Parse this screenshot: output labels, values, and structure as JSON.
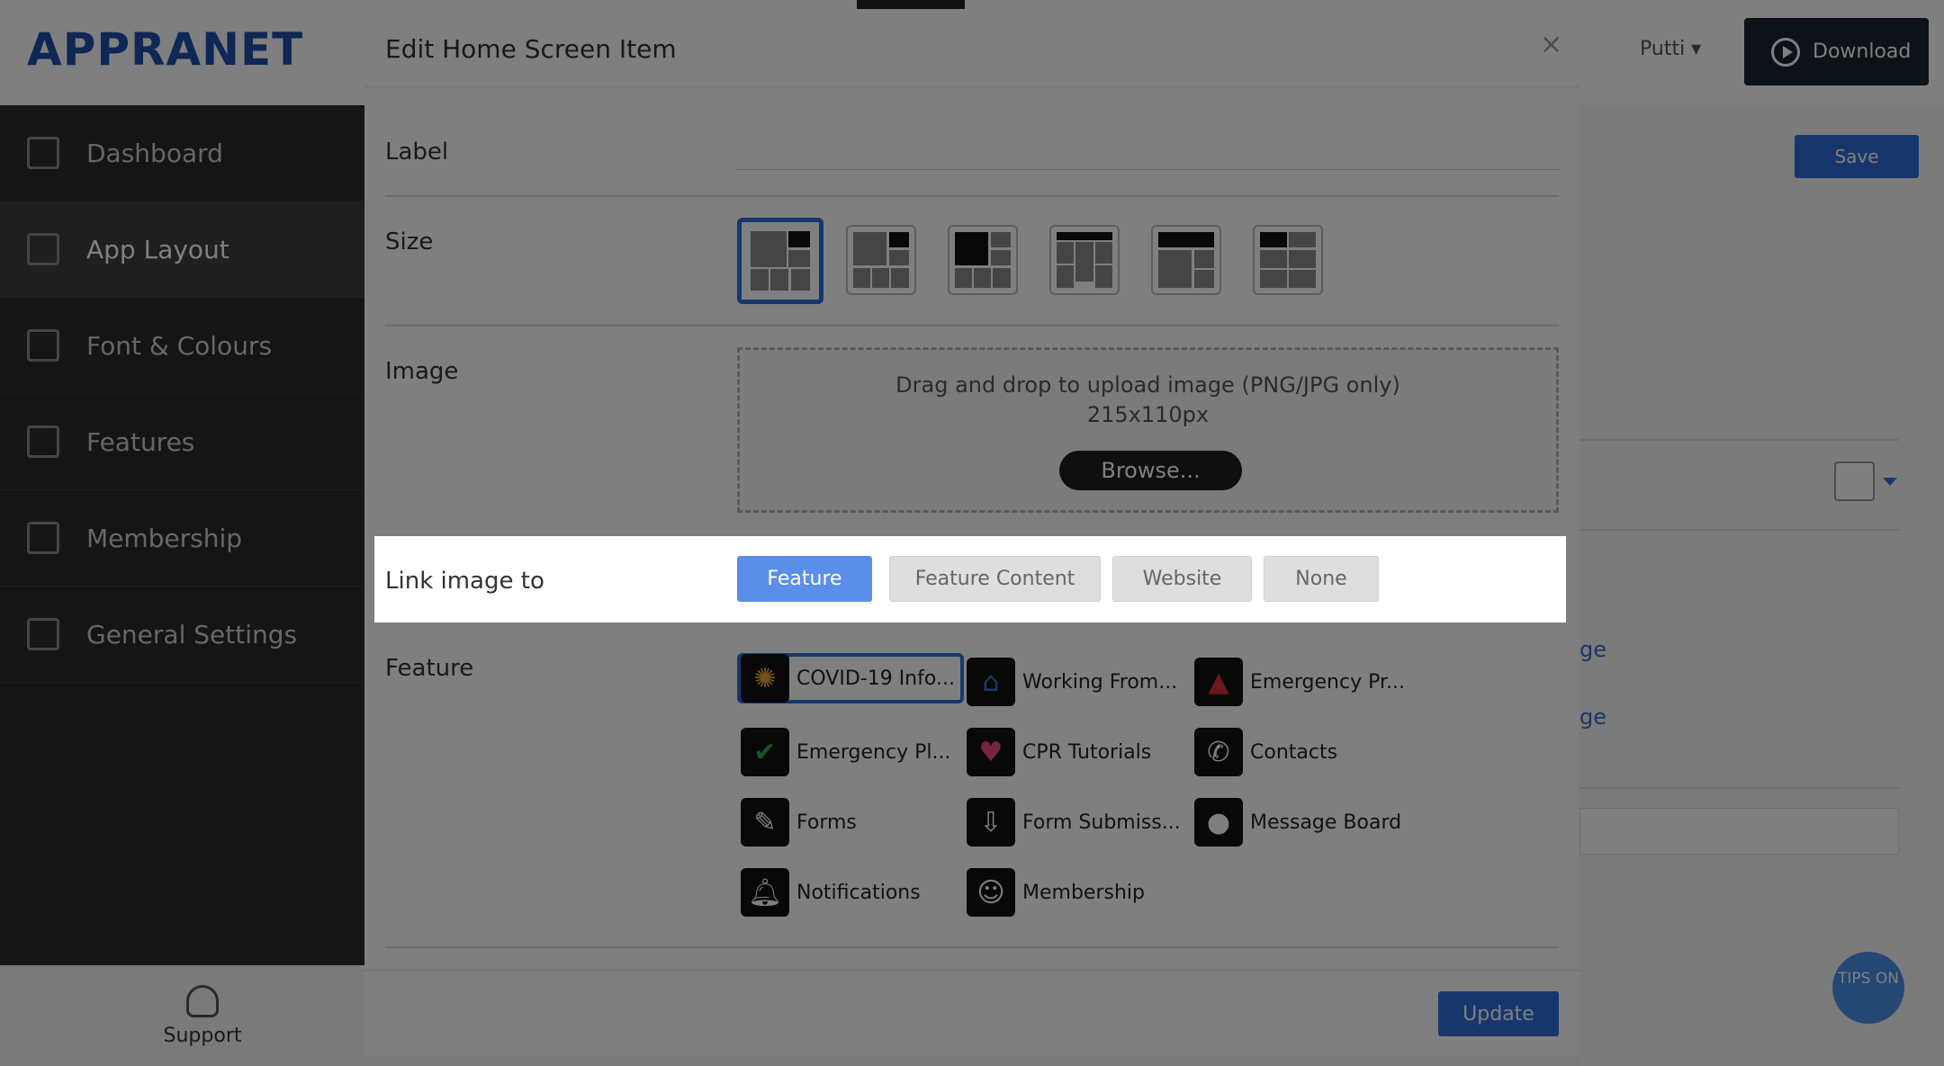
{
  "app": {
    "logo": "APPRANET",
    "user": "Putti",
    "download_label": "Download",
    "save_label": "Save",
    "tips_label": "TIPS ON"
  },
  "sidebar": {
    "items": [
      {
        "label": "Dashboard",
        "icon": "chart-icon"
      },
      {
        "label": "App Layout",
        "icon": "layers-icon",
        "active": true
      },
      {
        "label": "Font & Colours",
        "icon": "pencil-icon"
      },
      {
        "label": "Features",
        "icon": "monitor-icon"
      },
      {
        "label": "Membership",
        "icon": "id-card-icon"
      },
      {
        "label": "General Settings",
        "icon": "tools-icon"
      }
    ],
    "support_label": "Support"
  },
  "background": {
    "link_1": "ge",
    "link_2": "ge"
  },
  "modal": {
    "title": "Edit Home Screen Item",
    "close_label": "×",
    "label_row": {
      "label": "Label",
      "value": ""
    },
    "size_row": {
      "label": "Size",
      "options_count_selected_index": 0
    },
    "image_row": {
      "label": "Image",
      "dropzone_text": "Drag and drop to upload image (PNG/JPG only)",
      "dropzone_size": "215x110px",
      "browse_label": "Browse..."
    },
    "link_row": {
      "label": "Link image to",
      "options": [
        "Feature",
        "Feature Content",
        "Website",
        "None"
      ],
      "selected": "Feature"
    },
    "feature_row": {
      "label": "Feature",
      "items": [
        {
          "label": "COVID-19 Info...",
          "icon": "virus-icon",
          "color": "#e8a33a",
          "selected": true
        },
        {
          "label": "Working From...",
          "icon": "house-icon",
          "color": "#3a6fd8"
        },
        {
          "label": "Emergency Pr...",
          "icon": "warning-icon",
          "color": "#d8303a"
        },
        {
          "label": "Emergency Pl...",
          "icon": "shield-check-icon",
          "color": "#2fa84a"
        },
        {
          "label": "CPR Tutorials",
          "icon": "heart-icon",
          "color": "#e84a8a"
        },
        {
          "label": "Contacts",
          "icon": "phone-icon",
          "color": "#ffffff"
        },
        {
          "label": "Forms",
          "icon": "edit-icon",
          "color": "#ffffff"
        },
        {
          "label": "Form Submiss...",
          "icon": "inbox-icon",
          "color": "#ffffff"
        },
        {
          "label": "Message Board",
          "icon": "chat-bubble-icon",
          "color": "#ffffff"
        },
        {
          "label": "Notifications",
          "icon": "bell-icon",
          "color": "#ffffff"
        },
        {
          "label": "Membership",
          "icon": "user-circle-icon",
          "color": "#ffffff"
        }
      ]
    },
    "update_label": "Update"
  }
}
